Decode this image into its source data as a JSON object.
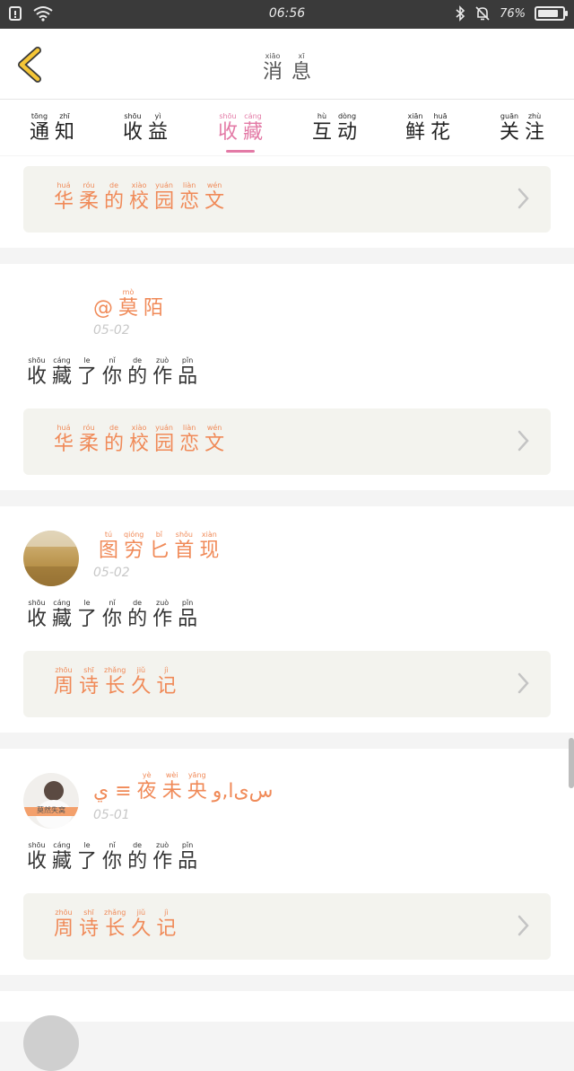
{
  "status_bar": {
    "time": "06:56",
    "battery": "76%"
  },
  "header": {
    "title": [
      {
        "py": "xiāo",
        "hz": "消"
      },
      {
        "py": "xī",
        "hz": "息"
      }
    ]
  },
  "tabs": [
    {
      "chars": [
        {
          "py": "tōng",
          "hz": "通"
        },
        {
          "py": "zhī",
          "hz": "知"
        }
      ]
    },
    {
      "chars": [
        {
          "py": "shōu",
          "hz": "收"
        },
        {
          "py": "yì",
          "hz": "益"
        }
      ]
    },
    {
      "chars": [
        {
          "py": "shōu",
          "hz": "收"
        },
        {
          "py": "cáng",
          "hz": "藏"
        }
      ],
      "active": true
    },
    {
      "chars": [
        {
          "py": "hù",
          "hz": "互"
        },
        {
          "py": "dòng",
          "hz": "动"
        }
      ]
    },
    {
      "chars": [
        {
          "py": "xiān",
          "hz": "鲜"
        },
        {
          "py": "huā",
          "hz": "花"
        }
      ]
    },
    {
      "chars": [
        {
          "py": "guān",
          "hz": "关"
        },
        {
          "py": "zhù",
          "hz": "注"
        }
      ]
    }
  ],
  "action_text": [
    {
      "py": "shōu",
      "hz": "收"
    },
    {
      "py": "cáng",
      "hz": "藏"
    },
    {
      "py": "le",
      "hz": "了"
    },
    {
      "py": "nǐ",
      "hz": "你"
    },
    {
      "py": "de",
      "hz": "的"
    },
    {
      "py": "zuò",
      "hz": "作"
    },
    {
      "py": "pǐn",
      "hz": "品"
    }
  ],
  "items": [
    {
      "work": [
        {
          "py": "huá",
          "hz": "华"
        },
        {
          "py": "róu",
          "hz": "柔"
        },
        {
          "py": "de",
          "hz": "的"
        },
        {
          "py": "xiào",
          "hz": "校"
        },
        {
          "py": "yuán",
          "hz": "园"
        },
        {
          "py": "liàn",
          "hz": "恋"
        },
        {
          "py": "wén",
          "hz": "文"
        }
      ]
    },
    {
      "user": [
        {
          "py": "",
          "hz": "@"
        },
        {
          "py": "mò",
          "hz": "莫"
        },
        {
          "py": "",
          "hz": "陌"
        }
      ],
      "date": "05-02",
      "work": [
        {
          "py": "huá",
          "hz": "华"
        },
        {
          "py": "róu",
          "hz": "柔"
        },
        {
          "py": "de",
          "hz": "的"
        },
        {
          "py": "xiào",
          "hz": "校"
        },
        {
          "py": "yuán",
          "hz": "园"
        },
        {
          "py": "liàn",
          "hz": "恋"
        },
        {
          "py": "wén",
          "hz": "文"
        }
      ]
    },
    {
      "user": [
        {
          "py": "tú",
          "hz": "图"
        },
        {
          "py": "qióng",
          "hz": "穷"
        },
        {
          "py": "bǐ",
          "hz": "匕"
        },
        {
          "py": "shǒu",
          "hz": "首"
        },
        {
          "py": "xiàn",
          "hz": "现"
        }
      ],
      "date": "05-02",
      "work": [
        {
          "py": "zhōu",
          "hz": "周"
        },
        {
          "py": "shī",
          "hz": "诗"
        },
        {
          "py": "zhǎng",
          "hz": "长"
        },
        {
          "py": "jiǔ",
          "hz": "久"
        },
        {
          "py": "jì",
          "hz": "记"
        }
      ]
    },
    {
      "user": [
        {
          "py": "",
          "hz": "ي ≡"
        },
        {
          "py": "yè",
          "hz": "夜"
        },
        {
          "py": "wèi",
          "hz": "未"
        },
        {
          "py": "yāng",
          "hz": "央"
        },
        {
          "py": "",
          "hz": "ﺱﻯﺍ,و"
        }
      ],
      "avatar_caption": "莫然失窝",
      "date": "05-01",
      "work": [
        {
          "py": "zhōu",
          "hz": "周"
        },
        {
          "py": "shī",
          "hz": "诗"
        },
        {
          "py": "zhǎng",
          "hz": "长"
        },
        {
          "py": "jiǔ",
          "hz": "久"
        },
        {
          "py": "jì",
          "hz": "记"
        }
      ]
    }
  ],
  "colors": {
    "accent_orange": "#f08a58",
    "accent_pink": "#e37aa6",
    "status_bar": "#3a3a3a"
  }
}
